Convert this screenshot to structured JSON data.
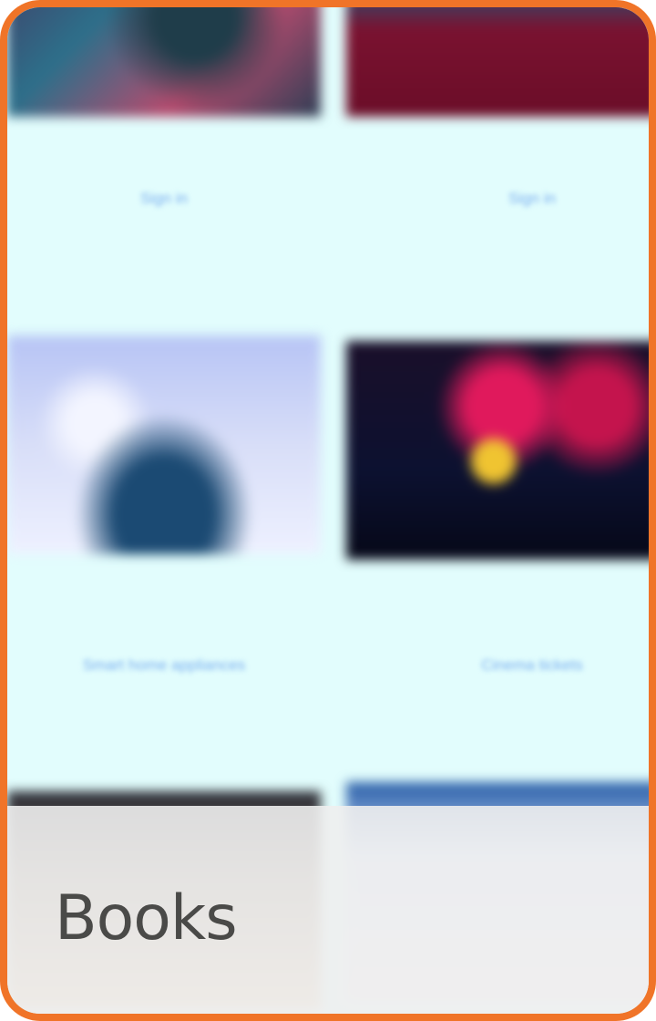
{
  "card": {
    "title": "Books",
    "accent_color": "#f07428",
    "background_color": "#e2fdfd"
  },
  "tiles": [
    {
      "caption": "Sign in"
    },
    {
      "caption": "Sign in"
    },
    {
      "caption": "Smart home appliances"
    },
    {
      "caption": "Cinema tickets"
    },
    {
      "caption": ""
    },
    {
      "caption": ""
    }
  ]
}
